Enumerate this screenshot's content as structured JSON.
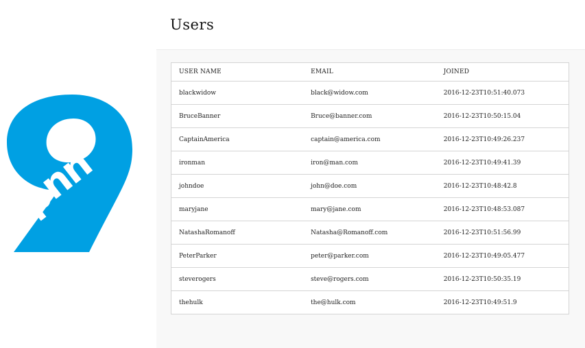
{
  "logo": {
    "text": "pnn",
    "color": "#00a0e3"
  },
  "page": {
    "title": "Users"
  },
  "table": {
    "columns": [
      "USER NAME",
      "EMAIL",
      "JOINED"
    ],
    "rows": [
      [
        "blackwidow",
        "black@widow.com",
        "2016-12-23T10:51:40.073"
      ],
      [
        "BruceBanner",
        "Bruce@banner.com",
        "2016-12-23T10:50:15.04"
      ],
      [
        "CaptainAmerica",
        "captain@america.com",
        "2016-12-23T10:49:26.237"
      ],
      [
        "ironman",
        "iron@man.com",
        "2016-12-23T10:49:41.39"
      ],
      [
        "johndoe",
        "john@doe.com",
        "2016-12-23T10:48:42.8"
      ],
      [
        "maryjane",
        "mary@jane.com",
        "2016-12-23T10:48:53.087"
      ],
      [
        "NatashaRomanoff",
        "Natasha@Romanoff.com",
        "2016-12-23T10:51:56.99"
      ],
      [
        "PeterParker",
        "peter@parker.com",
        "2016-12-23T10:49:05.477"
      ],
      [
        "steverogers",
        "steve@rogers.com",
        "2016-12-23T10:50:35.19"
      ],
      [
        "thehulk",
        "the@hulk.com",
        "2016-12-23T10:49:51.9"
      ]
    ]
  }
}
